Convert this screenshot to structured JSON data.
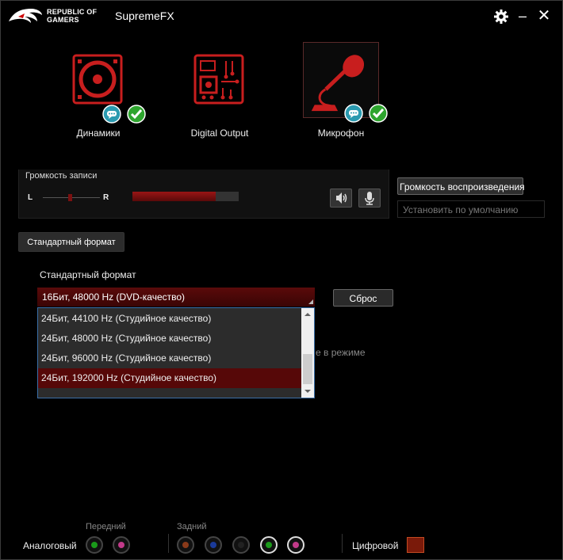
{
  "titlebar": {
    "brand_line1": "REPUBLIC OF",
    "brand_line2": "GAMERS",
    "title": "SupremeFX"
  },
  "devices": [
    {
      "label": "Динамики",
      "icon": "speaker-icon",
      "status": [
        "chat-bubble-icon",
        "checkmark-icon"
      ]
    },
    {
      "label": "Digital Output",
      "icon": "circuit-board-icon"
    },
    {
      "label": "Микрофон",
      "icon": "microphone-icon",
      "selected": true,
      "status": [
        "chat-bubble-icon",
        "checkmark-icon"
      ]
    }
  ],
  "record_volume": {
    "title": "Громкость записи",
    "left": "L",
    "right": "R",
    "level_percent": 78
  },
  "buttons": {
    "playback_volume": "Громкость воспроизведения",
    "set_default": "Установить по умолчанию",
    "default_format_tab": "Стандартный формат",
    "reset": "Сброс"
  },
  "default_format": {
    "label": "Стандартный формат",
    "selected": "16Бит, 48000 Hz (DVD-качество)",
    "options": [
      "24Бит, 44100 Hz (Студийное качество)",
      "24Бит, 48000 Hz (Студийное качество)",
      "24Бит, 96000 Hz (Студийное качество)",
      "24Бит, 192000 Hz (Студийное качество)"
    ],
    "highlighted_index": 3
  },
  "peek_text": "е в режиме",
  "jacks": {
    "analog_label": "Аналоговый",
    "front_label": "Передний",
    "rear_label": "Задний",
    "digital_label": "Цифровой",
    "colors": {
      "green": "#1a9a1a",
      "pink": "#c23a8a",
      "orange": "#8a3a1a",
      "blue": "#1a3a9a",
      "black": "#222222"
    }
  },
  "colors": {
    "accent": "#9a1515",
    "selection": "#560808",
    "check": "#2ea52e",
    "chat": "#2a9ab0"
  }
}
